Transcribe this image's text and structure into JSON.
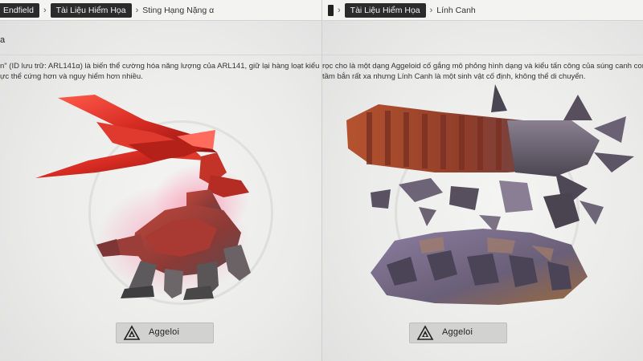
{
  "left": {
    "breadcrumb": {
      "game": "Endfield",
      "section": "Tài Liệu Hiểm Họa",
      "current": "Sting Hạng Nặng α"
    },
    "title_fragment": "a",
    "description_line1": "n\" (ID lưu trữ: ARL141α) là biến thể cường hóa năng lượng của ARL141, giữ lại hàng loạt kiểu tấn công",
    "description_line2": "ực thể cứng hơn và nguy hiểm hơn nhiều.",
    "tag": {
      "label": "Aggeloi",
      "icon": "aggeloi-icon"
    }
  },
  "right": {
    "breadcrumb": {
      "section": "Tài Liệu Hiểm Họa",
      "current": "Lính Canh"
    },
    "description_line1": "rọc cho là một dạng Aggeloid cố gắng mô phỏng hình dạng và kiểu tấn công của súng canh con",
    "description_line2": "tầm bắn rất xa nhưng Lính Canh là một sinh vật cố định, không thể di chuyển.",
    "tag": {
      "label": "Aggeloi",
      "icon": "aggeloi-icon"
    }
  },
  "colors": {
    "crumb_bg": "#2b2b2b",
    "crystal_red": "#d62b22",
    "rust": "#a8482a",
    "stone": "#6b6472"
  }
}
